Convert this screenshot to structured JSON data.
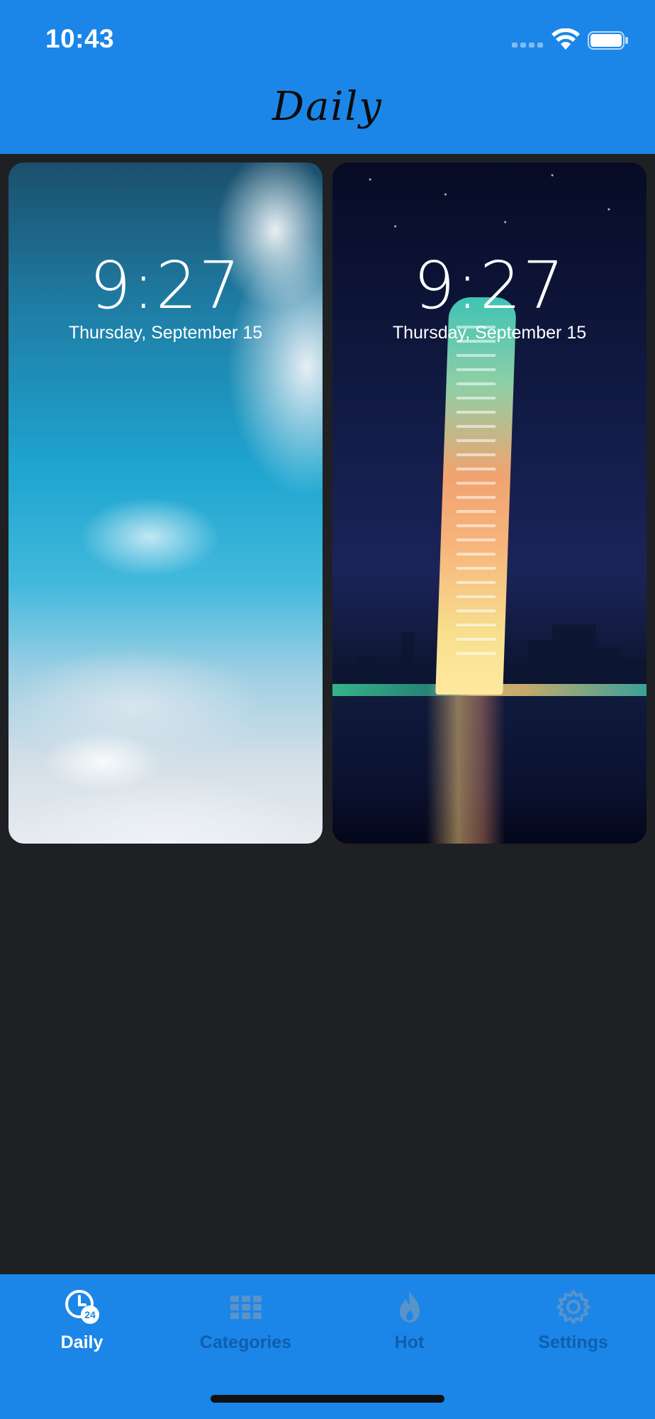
{
  "status_bar": {
    "time": "10:43"
  },
  "header": {
    "title": "Daily"
  },
  "wallpapers": [
    {
      "lock_time": "9:27",
      "lock_date": "Thursday, September 15",
      "theme": "clouds-sky"
    },
    {
      "lock_time": "9:27",
      "lock_date": "Thursday, September 15",
      "theme": "city-tower-night"
    }
  ],
  "tab_bar": {
    "tabs": [
      {
        "label": "Daily",
        "icon": "clock-24-icon",
        "active": true
      },
      {
        "label": "Categories",
        "icon": "grid-icon",
        "active": false
      },
      {
        "label": "Hot",
        "icon": "flame-icon",
        "active": false
      },
      {
        "label": "Settings",
        "icon": "gear-icon",
        "active": false
      }
    ]
  },
  "colors": {
    "accent": "#1b86e8",
    "background": "#1f2023",
    "tab_inactive": "#0f5fad",
    "tab_active": "#ffffff"
  }
}
